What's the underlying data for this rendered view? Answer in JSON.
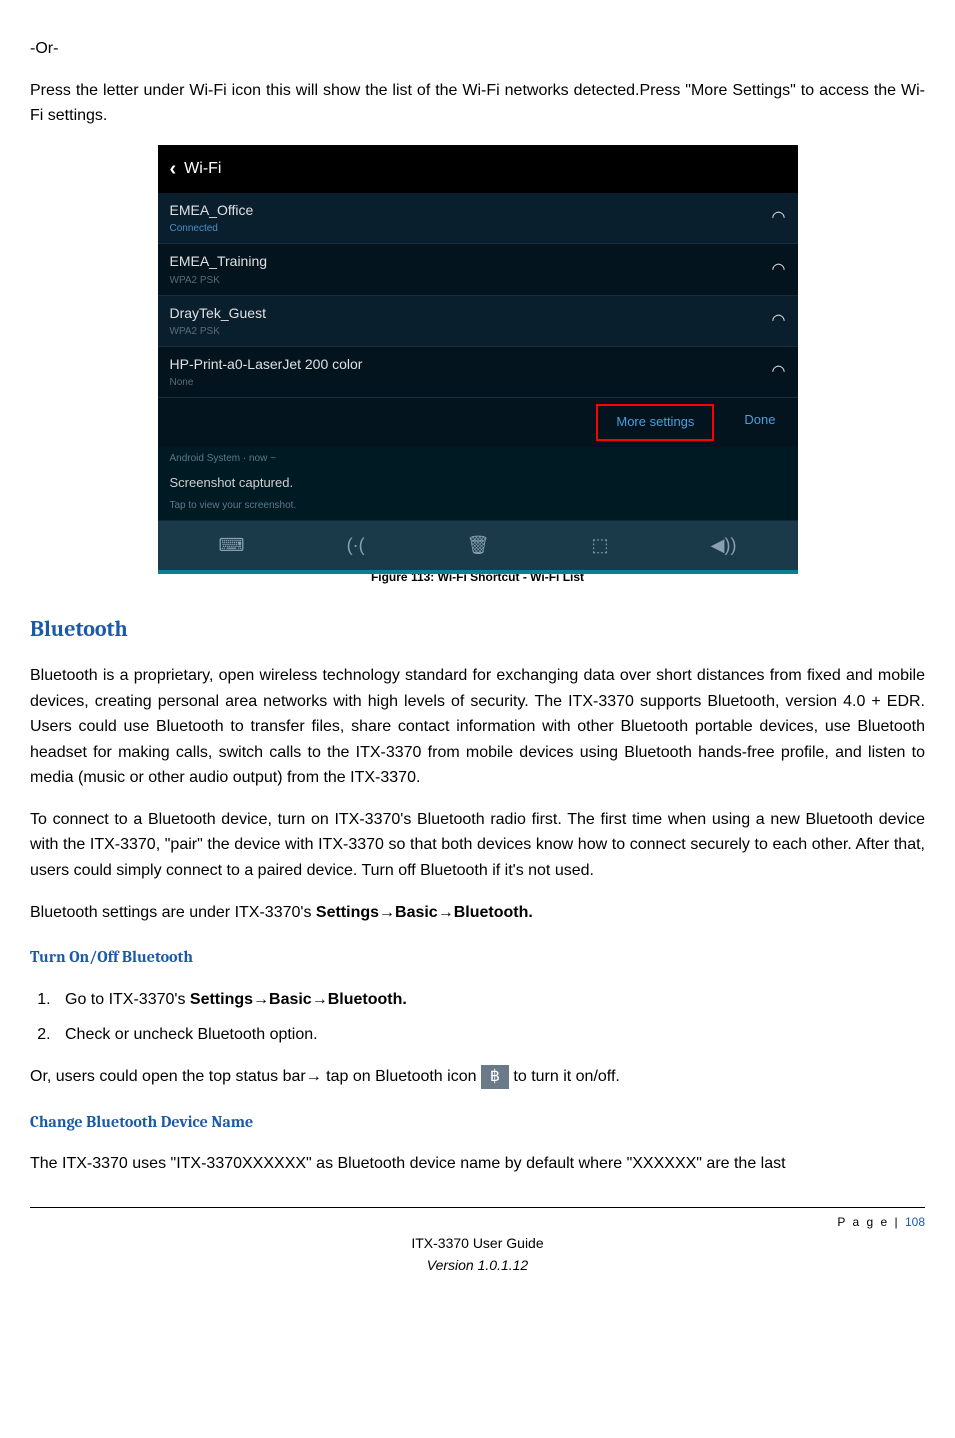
{
  "intro": {
    "or": " -Or-",
    "press_text": "Press the letter under Wi-Fi icon this will show the list of the Wi-Fi networks detected.Press \"More Settings\" to access the Wi-Fi settings."
  },
  "screenshot": {
    "header_title": "Wi-Fi",
    "networks": [
      {
        "name": "EMEA_Office",
        "sub": "Connected",
        "sub_class": "wifi-sub"
      },
      {
        "name": "EMEA_Training",
        "sub": "WPA2 PSK",
        "sub_class": "wifi-sub-gray"
      },
      {
        "name": "DrayTek_Guest",
        "sub": "WPA2 PSK",
        "sub_class": "wifi-sub-gray"
      },
      {
        "name": "HP-Print-a0-LaserJet 200 color",
        "sub": "None",
        "sub_class": "wifi-sub-gray"
      }
    ],
    "more_settings": "More settings",
    "done": "Done",
    "notif_header": "Android System · now ~",
    "notif_title": "Screenshot captured.",
    "notif_sub": "Tap to view your screenshot."
  },
  "figure_caption": "Figure 113: Wi-Fi Shortcut - Wi-Fi List",
  "bluetooth": {
    "heading": "Bluetooth",
    "para1": "Bluetooth is a proprietary, open wireless technology standard for exchanging data over short distances from fixed and mobile devices, creating personal area networks with high levels of security. The ITX-3370 supports Bluetooth, version 4.0 + EDR. Users could use Bluetooth to transfer files, share contact information with other Bluetooth portable devices, use Bluetooth headset for making calls, switch calls to the ITX-3370 from mobile devices using Bluetooth hands-free profile, and listen to media (music or other audio output) from the ITX-3370.",
    "para2": "To connect to a Bluetooth device, turn on ITX-3370's Bluetooth radio first. The first time when using a new Bluetooth device with the ITX-3370, \"pair\" the device with ITX-3370 so that both devices know how to connect securely to each other. After that, users could simply connect to a paired device. Turn off Bluetooth if it's not used.",
    "para3_pre": "Bluetooth settings are under ITX-3370's ",
    "para3_bold": "Settings→Basic→Bluetooth."
  },
  "turn_on_off": {
    "heading": "Turn On/Off Bluetooth",
    "step1_pre": "Go to ITX-3370's ",
    "step1_bold": "Settings→Basic→Bluetooth.",
    "step2": "Check or uncheck Bluetooth option.",
    "or_text_pre": "Or, users could open the top status bar→ tap on Bluetooth icon ",
    "or_text_post": " to turn it on/off."
  },
  "change_name": {
    "heading": "Change Bluetooth Device Name",
    "para": "The ITX-3370 uses \"ITX-3370XXXXXX\" as Bluetooth device name by default where \"XXXXXX\" are the last"
  },
  "footer": {
    "page_label": "P a g e | ",
    "page_num": "108",
    "title": "ITX-3370 User Guide",
    "version": "Version 1.0.1.12"
  }
}
